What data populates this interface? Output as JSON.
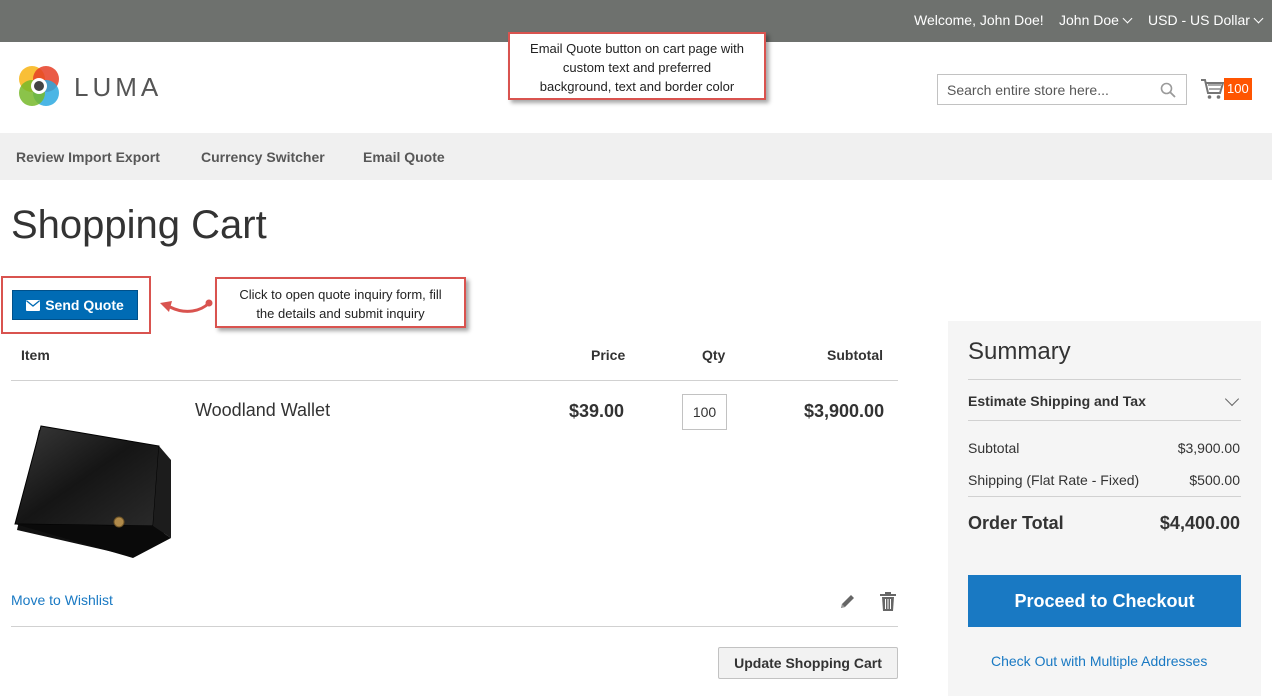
{
  "header": {
    "welcome": "Welcome, John Doe!",
    "account": "John Doe",
    "currency": "USD - US Dollar",
    "logo_text": "LUMA",
    "search_placeholder": "Search entire store here...",
    "cart_count": "100"
  },
  "callouts": {
    "email_quote": [
      "Email Quote button on cart page with",
      "custom text and preferred",
      "background, text and border color"
    ],
    "send_quote": [
      "Click to open quote inquiry form, fill",
      "the details and submit inquiry"
    ]
  },
  "nav": {
    "items": [
      "Review Import Export",
      "Currency Switcher",
      "Email Quote"
    ]
  },
  "page_title": "Shopping Cart",
  "send_quote_label": "Send Quote",
  "cart": {
    "columns": [
      "Item",
      "Price",
      "Qty",
      "Subtotal"
    ],
    "items": [
      {
        "name": "Woodland Wallet",
        "price": "$39.00",
        "qty": "100",
        "subtotal": "$3,900.00"
      }
    ],
    "move_to_wishlist": "Move to Wishlist",
    "update_label": "Update Shopping Cart"
  },
  "summary": {
    "title": "Summary",
    "estimate": "Estimate Shipping and Tax",
    "subtotal_label": "Subtotal",
    "subtotal_value": "$3,900.00",
    "shipping_label": "Shipping (Flat Rate - Fixed)",
    "shipping_value": "$500.00",
    "order_total_label": "Order Total",
    "order_total_value": "$4,400.00",
    "checkout_label": "Proceed to Checkout",
    "multi_address": "Check Out with Multiple Addresses"
  },
  "colors": {
    "topbar": "#6e716e",
    "send_quote_bg": "#006bb4",
    "checkout_bg": "#1979c3",
    "cart_badge": "#ff5501",
    "callout_border": "#d9534f"
  }
}
